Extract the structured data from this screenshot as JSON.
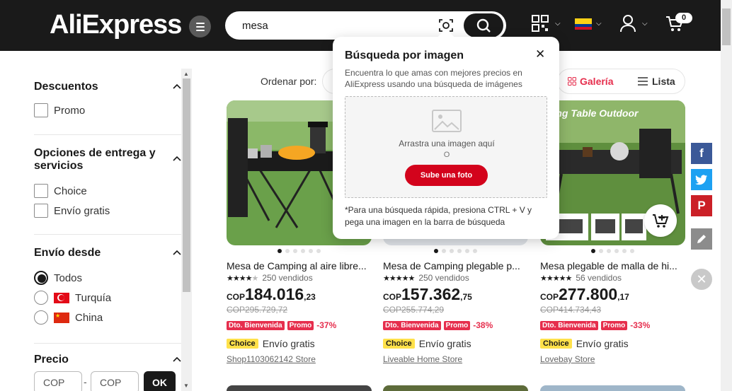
{
  "header": {
    "logo": "AliExpress",
    "search_value": "mesa",
    "cart_count": "0",
    "icons": [
      "menu-icon",
      "camera-search-icon",
      "search-icon",
      "qr-code-icon",
      "flag-colombia-icon",
      "user-icon",
      "cart-icon"
    ]
  },
  "sidebar": {
    "discounts": {
      "title": "Descuentos",
      "options": [
        "Promo"
      ]
    },
    "delivery": {
      "title": "Opciones de entrega y servicios",
      "options": [
        "Choice",
        "Envío gratis"
      ]
    },
    "ship_from": {
      "title": "Envío desde",
      "options": [
        "Todos",
        "Turquía",
        "China"
      ],
      "selected": "Todos"
    },
    "price": {
      "title": "Precio",
      "min_placeholder": "COP",
      "max_placeholder": "COP",
      "separator": "-",
      "ok_label": "OK"
    }
  },
  "toolbar": {
    "sort_label": "Ordenar por:",
    "view_gallery": "Galería",
    "view_list": "Lista"
  },
  "popup": {
    "title": "Búsqueda por imagen",
    "description": "Encuentra lo que amas con mejores precios en AliExpress usando una búsqueda de imágenes",
    "drop_text": "Arrastra una imagen aquí",
    "or_text": "O",
    "upload_label": "Sube una foto",
    "footer": "*Para una búsqueda rápida, presiona CTRL + V y pega una imagen en la barra de búsqueda"
  },
  "products": [
    {
      "title": "Mesa de Camping al aire libre...",
      "sold": "250 vendidos",
      "rating": 4.5,
      "currency": "COP",
      "price_main": "184.016",
      "price_dec": ",23",
      "old_price": "COP295.729,72",
      "tag_welcome": "Dto. Bienvenida",
      "tag_promo": "Promo",
      "discount": "-37%",
      "choice": "Choice",
      "shipping": "Envío gratis",
      "store": "Shop1103062142 Store"
    },
    {
      "title": "Mesa de Camping plegable p...",
      "sold": "250 vendidos",
      "rating": 5,
      "currency": "COP",
      "price_main": "157.362",
      "price_dec": ",75",
      "old_price": "COP255.774,29",
      "tag_welcome": "Dto. Bienvenida",
      "tag_promo": "Promo",
      "discount": "-38%",
      "choice": "Choice",
      "shipping": "Envío gratis",
      "store": "Liveable Home Store"
    },
    {
      "title": "Mesa plegable de malla de hi...",
      "sold": "56 vendidos",
      "rating": 5,
      "currency": "COP",
      "price_main": "277.800",
      "price_dec": ",17",
      "old_price": "COP414.734,43",
      "tag_welcome": "Dto. Bienvenida",
      "tag_promo": "Promo",
      "discount": "-33%",
      "choice": "Choice",
      "shipping": "Envío gratis",
      "store": "Lovebay Store",
      "image_caption": "lding Table Outdoor"
    }
  ],
  "colors": {
    "header_bg": "#1a1a1a",
    "accent_red": "#e62e4d",
    "upload_red": "#d3031c",
    "choice_yellow": "#ffe14a",
    "facebook": "#3b5998",
    "twitter": "#1da1f2",
    "pinterest": "#cb2027"
  },
  "social": [
    "facebook-icon",
    "twitter-icon",
    "pinterest-icon",
    "edit-icon",
    "close-icon"
  ]
}
